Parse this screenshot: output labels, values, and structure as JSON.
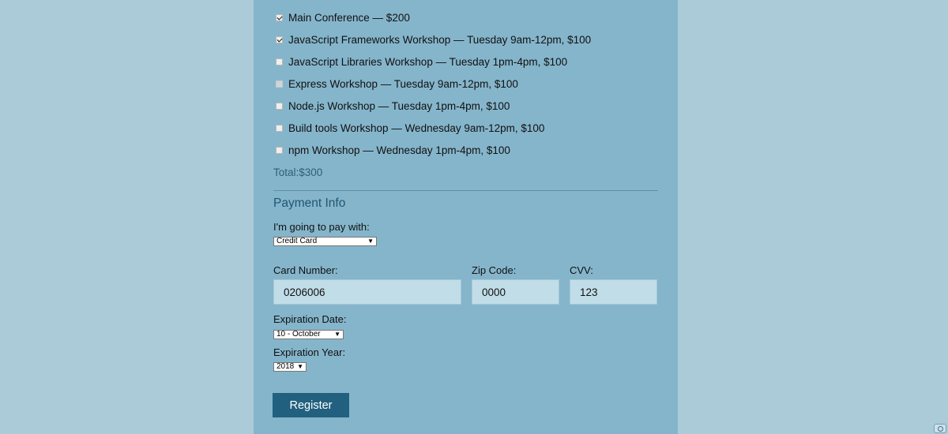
{
  "activities": [
    {
      "label": "Main Conference — $200",
      "checked": true,
      "disabled": false
    },
    {
      "label": "JavaScript Frameworks Workshop — Tuesday 9am-12pm, $100",
      "checked": true,
      "disabled": false
    },
    {
      "label": "JavaScript Libraries Workshop — Tuesday 1pm-4pm, $100",
      "checked": false,
      "disabled": false
    },
    {
      "label": "Express Workshop — Tuesday 9am-12pm, $100",
      "checked": false,
      "disabled": true
    },
    {
      "label": "Node.js Workshop — Tuesday 1pm-4pm, $100",
      "checked": false,
      "disabled": false
    },
    {
      "label": "Build tools Workshop — Wednesday 9am-12pm, $100",
      "checked": false,
      "disabled": false
    },
    {
      "label": "npm Workshop — Wednesday 1pm-4pm, $100",
      "checked": false,
      "disabled": false
    }
  ],
  "total": "Total:$300",
  "payment": {
    "title": "Payment Info",
    "method_label": "I'm going to pay with:",
    "method_value": "Credit Card",
    "card_number_label": "Card Number:",
    "card_number_value": "0206006",
    "zip_label": "Zip Code:",
    "zip_value": "0000",
    "cvv_label": "CVV:",
    "cvv_value": "123",
    "exp_date_label": "Expiration Date:",
    "exp_date_value": "10 - October",
    "exp_year_label": "Expiration Year:",
    "exp_year_value": "2018"
  },
  "register_label": "Register",
  "icons": {
    "select_arrow": "▼",
    "corner": "browser-extension-icon"
  },
  "colors": {
    "page_bg": "#abcbd8",
    "panel_bg": "#85b5cb",
    "accent": "#22607f",
    "input_bg": "#c1dde8"
  }
}
